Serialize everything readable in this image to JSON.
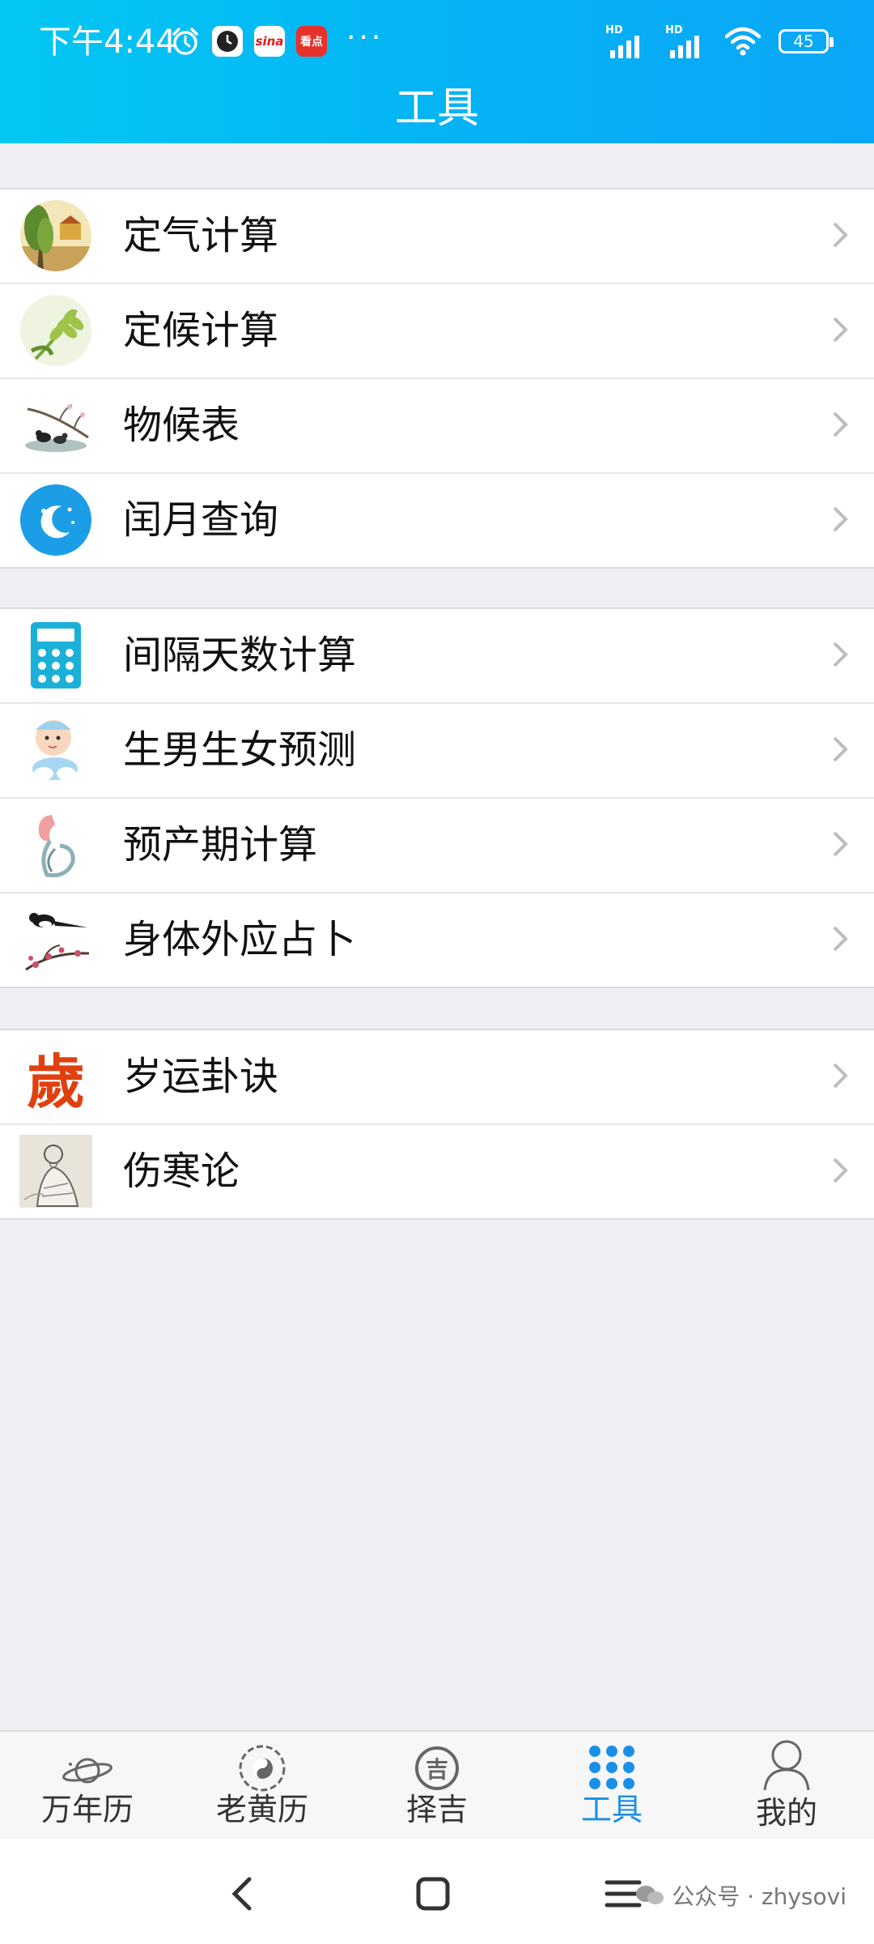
{
  "status_bar": {
    "time": "下午4:44",
    "hd_labels": [
      "HD",
      "HD"
    ],
    "battery": "45",
    "more_dots": "···",
    "app_badges": [
      "sina",
      "看点"
    ]
  },
  "header": {
    "title": "工具"
  },
  "groups": [
    {
      "items": [
        {
          "label": "定气计算",
          "icon": "landscape-tree-icon"
        },
        {
          "label": "定候计算",
          "icon": "wheat-icon"
        },
        {
          "label": "物候表",
          "icon": "branch-birds-icon"
        },
        {
          "label": "闰月查询",
          "icon": "moon-stars-icon"
        }
      ]
    },
    {
      "items": [
        {
          "label": "间隔天数计算",
          "icon": "calculator-icon"
        },
        {
          "label": "生男生女预测",
          "icon": "baby-icon"
        },
        {
          "label": "预产期计算",
          "icon": "pregnant-icon"
        },
        {
          "label": "身体外应占卜",
          "icon": "magpie-plum-icon"
        }
      ]
    },
    {
      "items": [
        {
          "label": "岁运卦诀",
          "icon": "sui-character-icon",
          "icon_text": "歲"
        },
        {
          "label": "伤寒论",
          "icon": "scholar-portrait-icon"
        }
      ]
    }
  ],
  "tabbar": {
    "tabs": [
      {
        "label": "万年历",
        "icon": "planet-icon",
        "active": false
      },
      {
        "label": "老黄历",
        "icon": "bagua-icon",
        "active": false
      },
      {
        "label": "择吉",
        "icon": "ji-seal-icon",
        "icon_text": "吉",
        "active": false
      },
      {
        "label": "工具",
        "icon": "dots-grid-icon",
        "active": true
      },
      {
        "label": "我的",
        "icon": "user-icon",
        "active": false
      }
    ]
  },
  "watermark": {
    "text": "公众号 · zhysovi"
  },
  "colors": {
    "header_start": "#03c7f3",
    "header_end": "#0ba6f7",
    "active_tab": "#1a8fe8",
    "background": "#efeff4"
  }
}
